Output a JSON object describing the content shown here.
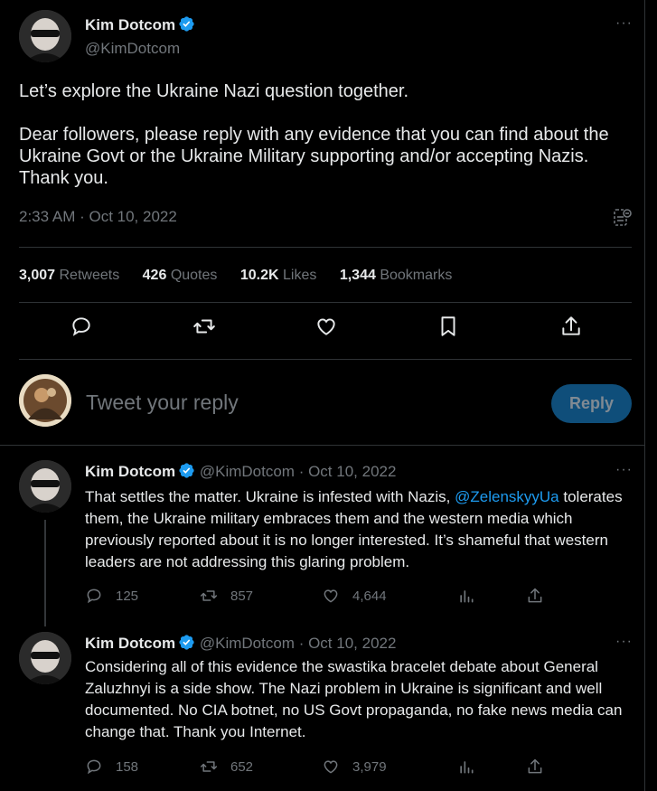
{
  "main_tweet": {
    "author_name": "Kim Dotcom",
    "author_handle": "@KimDotcom",
    "text": "Let’s explore the Ukraine Nazi question together.\n\nDear followers, please reply with any evidence that you can find about the Ukraine Govt or the Ukraine Military supporting and/or accepting Nazis. Thank you.",
    "timestamp": "2:33 AM · Oct 10, 2022",
    "stats": {
      "retweets_count": "3,007",
      "retweets_label": "Retweets",
      "quotes_count": "426",
      "quotes_label": "Quotes",
      "likes_count": "10.2K",
      "likes_label": "Likes",
      "bookmarks_count": "1,344",
      "bookmarks_label": "Bookmarks"
    },
    "more": "···"
  },
  "composer": {
    "placeholder": "Tweet your reply",
    "reply_button": "Reply"
  },
  "replies": [
    {
      "author_name": "Kim Dotcom",
      "author_handle": "@KimDotcom",
      "date": "· Oct 10, 2022",
      "text_before": "That settles the matter. Ukraine is infested with Nazis, ",
      "mention": "@ZelenskyyUa",
      "text_after": " tolerates them, the Ukraine military embraces them and the western media which previously reported about it is no longer interested. It’s shameful that western leaders are not addressing this glaring problem.",
      "replies": "125",
      "retweets": "857",
      "likes": "4,644"
    },
    {
      "author_name": "Kim Dotcom",
      "author_handle": "@KimDotcom",
      "date": "· Oct 10, 2022",
      "text": "Considering all of this evidence  the swastika bracelet debate about General Zaluzhnyi is a side show. The Nazi problem in Ukraine is significant and well documented. No CIA botnet, no US Govt propaganda, no fake news media can change that. Thank you Internet.",
      "replies": "158",
      "retweets": "652",
      "likes": "3,979"
    }
  ],
  "colors": {
    "accent": "#1d9bf0",
    "muted": "#71767b",
    "text": "#e7e9ea",
    "reply_button_bg": "#0f4e7a"
  },
  "icons": [
    "verified-badge-icon",
    "more-icon",
    "reply-icon",
    "retweet-icon",
    "like-icon",
    "bookmark-icon",
    "share-icon",
    "views-icon",
    "engagements-icon"
  ]
}
